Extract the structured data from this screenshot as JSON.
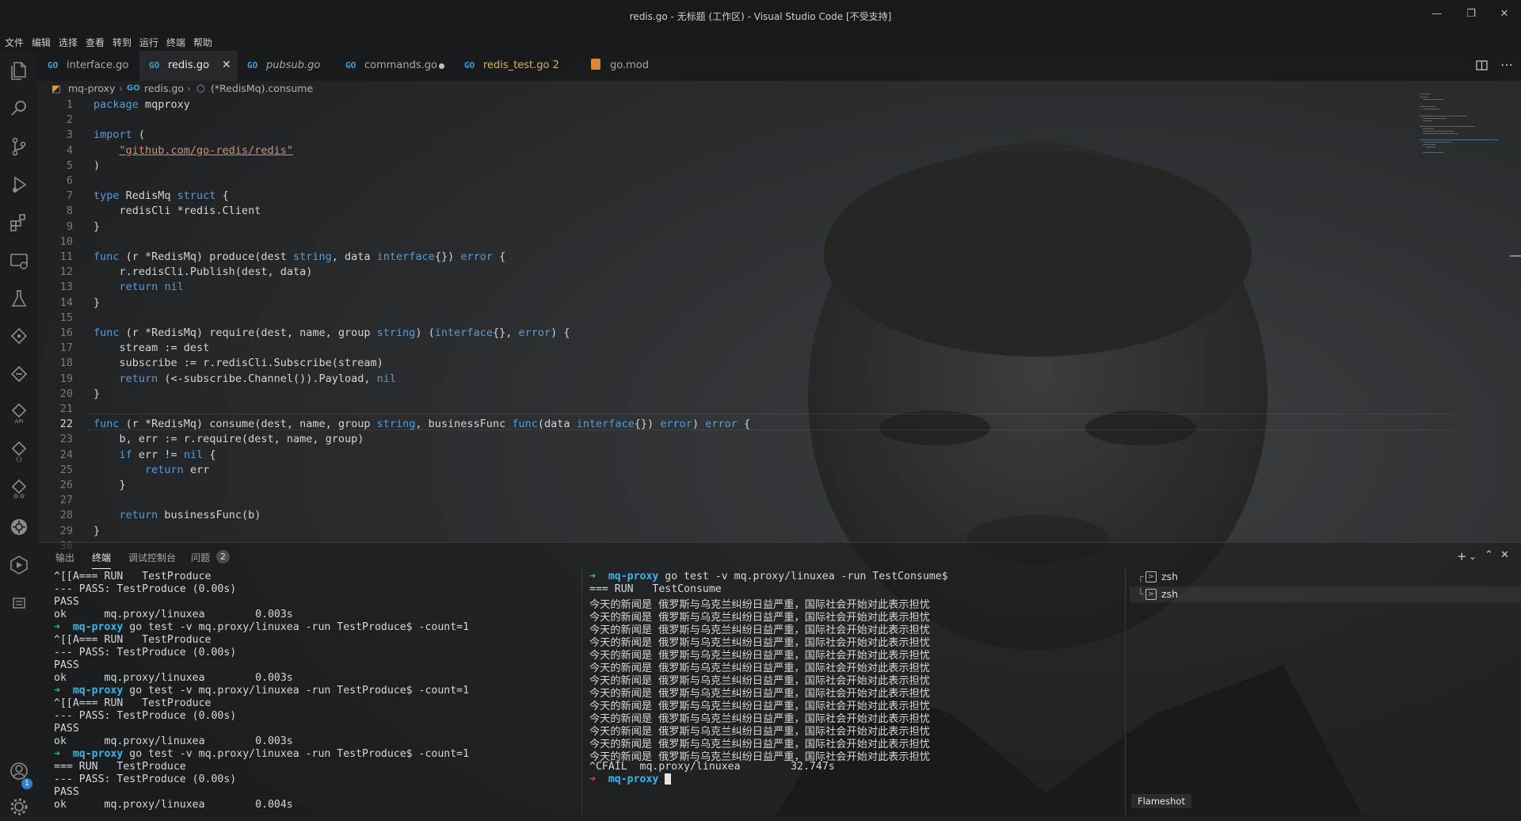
{
  "window": {
    "title": "redis.go - 无标题 (工作区) - Visual Studio Code [不受支持]",
    "controls": [
      "—",
      "❐",
      "✕"
    ]
  },
  "menu": [
    "文件",
    "编辑",
    "选择",
    "查看",
    "转到",
    "运行",
    "终端",
    "帮助"
  ],
  "tabs": [
    {
      "label": "interface.go",
      "icon": "go-file-icon",
      "state": "normal"
    },
    {
      "label": "redis.go",
      "icon": "go-file-icon",
      "state": "active",
      "close": "✕"
    },
    {
      "label": "pubsub.go",
      "icon": "go-file-icon",
      "state": "preview"
    },
    {
      "label": "commands.go",
      "icon": "go-file-icon",
      "state": "modified"
    },
    {
      "label": "redis_test.go 2",
      "icon": "go-file-icon",
      "state": "warning"
    },
    {
      "label": "go.mod",
      "icon": "gomod-file-icon",
      "state": "normal"
    }
  ],
  "breadcrumb": [
    "mq-proxy",
    "redis.go",
    "(*RedisMq).consume"
  ],
  "editor": {
    "current_line": 22,
    "lines": [
      "package mqproxy",
      "",
      "import (",
      "    \"github.com/go-redis/redis\"",
      ")",
      "",
      "type RedisMq struct {",
      "    redisCli *redis.Client",
      "}",
      "",
      "func (r *RedisMq) produce(dest string, data interface{}) error {",
      "    r.redisCli.Publish(dest, data)",
      "    return nil",
      "}",
      "",
      "func (r *RedisMq) require(dest, name, group string) (interface{}, error) {",
      "    stream := dest",
      "    subscribe := r.redisCli.Subscribe(stream)",
      "    return (<-subscribe.Channel()).Payload, nil",
      "}",
      "",
      "func (r *RedisMq) consume(dest, name, group string, businessFunc func(data interface{}) error) error {",
      "    b, err := r.require(dest, name, group)",
      "    if err != nil {",
      "        return err",
      "    }",
      "",
      "    return businessFunc(b)",
      "}",
      ""
    ]
  },
  "panel": {
    "tabs": [
      {
        "label": "输出",
        "active": false
      },
      {
        "label": "终端",
        "active": true
      },
      {
        "label": "调试控制台",
        "active": false
      },
      {
        "label": "问题",
        "active": false,
        "badge": "2"
      }
    ],
    "controls": [
      "+",
      "⌄",
      "⌃",
      "✕"
    ],
    "terminal_left": [
      {
        "t": "^[[A=== RUN   TestProduce"
      },
      {
        "t": "--- PASS: TestProduce (0.00s)"
      },
      {
        "t": "PASS"
      },
      {
        "t": "ok      mq.proxy/linuxea        0.003s"
      },
      {
        "prompt": "mq-proxy",
        "cmd": " go test -v mq.proxy/linuxea -run TestProduce$ -count=1"
      },
      {
        "t": "^[[A=== RUN   TestProduce"
      },
      {
        "t": "--- PASS: TestProduce (0.00s)"
      },
      {
        "t": "PASS"
      },
      {
        "t": "ok      mq.proxy/linuxea        0.003s"
      },
      {
        "prompt": "mq-proxy",
        "cmd": " go test -v mq.proxy/linuxea -run TestProduce$ -count=1"
      },
      {
        "t": "^[[A=== RUN   TestProduce"
      },
      {
        "t": "--- PASS: TestProduce (0.00s)"
      },
      {
        "t": "PASS"
      },
      {
        "t": "ok      mq.proxy/linuxea        0.003s"
      },
      {
        "prompt": "mq-proxy",
        "cmd": " go test -v mq.proxy/linuxea -run TestProduce$ -count=1"
      },
      {
        "t": "=== RUN   TestProduce"
      },
      {
        "t": "--- PASS: TestProduce (0.00s)"
      },
      {
        "t": "PASS"
      },
      {
        "t": "ok      mq.proxy/linuxea        0.004s"
      }
    ],
    "terminal_right": [
      {
        "prompt": "mq-proxy",
        "cmd": " go test -v mq.proxy/linuxea -run TestConsume$"
      },
      {
        "t": "=== RUN   TestConsume"
      },
      {
        "t": "今天的新闻是 俄罗斯与乌克兰纠纷日益严重，国际社会开始对此表示担忧"
      },
      {
        "t": "今天的新闻是 俄罗斯与乌克兰纠纷日益严重，国际社会开始对此表示担忧"
      },
      {
        "t": "今天的新闻是 俄罗斯与乌克兰纠纷日益严重，国际社会开始对此表示担忧"
      },
      {
        "t": "今天的新闻是 俄罗斯与乌克兰纠纷日益严重，国际社会开始对此表示担忧"
      },
      {
        "t": "今天的新闻是 俄罗斯与乌克兰纠纷日益严重，国际社会开始对此表示担忧"
      },
      {
        "t": "今天的新闻是 俄罗斯与乌克兰纠纷日益严重，国际社会开始对此表示担忧"
      },
      {
        "t": "今天的新闻是 俄罗斯与乌克兰纠纷日益严重，国际社会开始对此表示担忧"
      },
      {
        "t": "今天的新闻是 俄罗斯与乌克兰纠纷日益严重，国际社会开始对此表示担忧"
      },
      {
        "t": "今天的新闻是 俄罗斯与乌克兰纠纷日益严重，国际社会开始对此表示担忧"
      },
      {
        "t": "今天的新闻是 俄罗斯与乌克兰纠纷日益严重，国际社会开始对此表示担忧"
      },
      {
        "t": "今天的新闻是 俄罗斯与乌克兰纠纷日益严重，国际社会开始对此表示担忧"
      },
      {
        "t": "今天的新闻是 俄罗斯与乌克兰纠纷日益严重，国际社会开始对此表示担忧"
      },
      {
        "t": "今天的新闻是 俄罗斯与乌克兰纠纷日益严重，国际社会开始对此表示担忧"
      },
      {
        "t": "^CFAIL  mq.proxy/linuxea        32.747s"
      },
      {
        "prompt_red": "mq-proxy",
        "cursor": true
      }
    ],
    "terminal_list": [
      {
        "label": "zsh",
        "tree": "┌"
      },
      {
        "label": "zsh",
        "tree": "└",
        "selected": true
      }
    ]
  },
  "activity_badge": "1",
  "tooltip": "Flameshot",
  "colors": {
    "keyword": "#569cd6",
    "string": "#ce9178",
    "prompt_green": "#2fc46a",
    "prompt_cyan": "#3fb4e6",
    "prompt_red": "#e64848"
  }
}
